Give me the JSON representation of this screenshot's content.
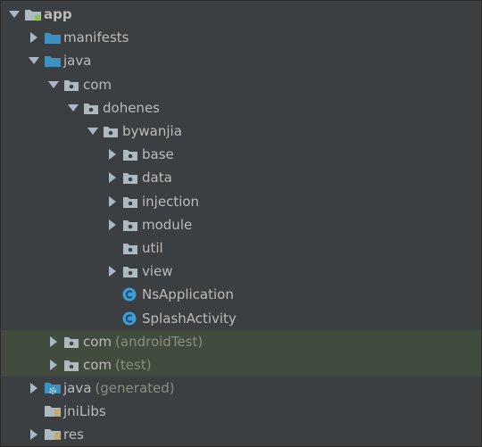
{
  "colors": {
    "background": "#3c3f41",
    "highlight": "#414b3e",
    "text": "#bbbbbb",
    "suffix_text": "#8a8f7c",
    "folder_gray": "#aeb9c0",
    "folder_blue": "#3c91be",
    "class_badge": "#3a9fd8"
  },
  "tree": {
    "root": {
      "label": "app",
      "icon": "android-module-folder-icon",
      "state": "expanded"
    },
    "manifests": {
      "label": "manifests",
      "icon": "source-folder-icon",
      "state": "collapsed"
    },
    "java": {
      "label": "java",
      "icon": "source-folder-icon",
      "state": "expanded"
    },
    "com": {
      "label": "com",
      "icon": "package-icon",
      "state": "expanded"
    },
    "dohenes": {
      "label": "dohenes",
      "icon": "package-icon",
      "state": "expanded"
    },
    "bywanjia": {
      "label": "bywanjia",
      "icon": "package-icon",
      "state": "expanded"
    },
    "base": {
      "label": "base",
      "icon": "package-icon",
      "state": "collapsed"
    },
    "data": {
      "label": "data",
      "icon": "package-icon",
      "state": "collapsed"
    },
    "injection": {
      "label": "injection",
      "icon": "package-icon",
      "state": "collapsed"
    },
    "module": {
      "label": "module",
      "icon": "package-icon",
      "state": "collapsed"
    },
    "util": {
      "label": "util",
      "icon": "package-icon"
    },
    "view": {
      "label": "view",
      "icon": "package-icon",
      "state": "collapsed"
    },
    "ns_application": {
      "label": "NsApplication",
      "icon": "java-class-icon"
    },
    "splash_activity": {
      "label": "SplashActivity",
      "icon": "java-class-icon"
    },
    "com_android_test": {
      "label": "com",
      "suffix": "(androidTest)",
      "icon": "package-icon",
      "state": "collapsed"
    },
    "com_test": {
      "label": "com",
      "suffix": "(test)",
      "icon": "package-icon",
      "state": "collapsed"
    },
    "java_generated": {
      "label": "java",
      "suffix": "(generated)",
      "icon": "generated-source-folder-icon",
      "state": "collapsed"
    },
    "jni_libs": {
      "label": "jniLibs",
      "icon": "resource-folder-icon"
    },
    "res": {
      "label": "res",
      "icon": "resource-folder-icon",
      "state": "collapsed"
    }
  }
}
